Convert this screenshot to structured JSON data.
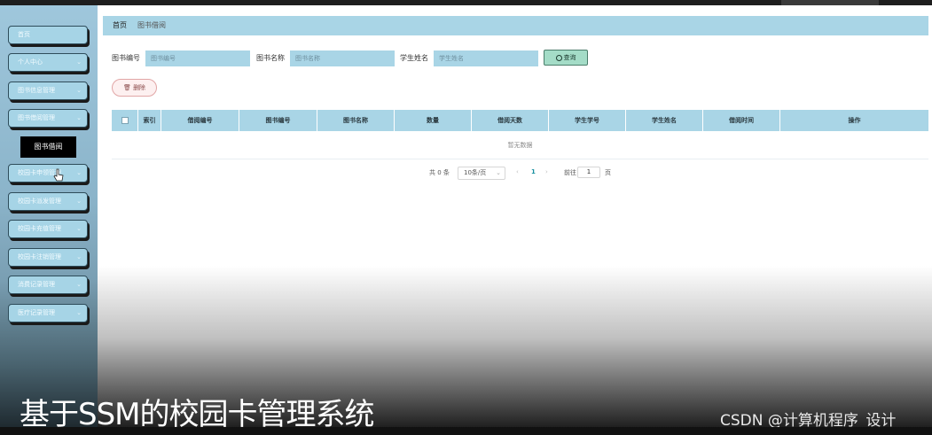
{
  "sidebar": {
    "items": [
      {
        "label": "首页",
        "has_chevron": false
      },
      {
        "label": "个人中心",
        "has_chevron": true
      },
      {
        "label": "图书信息管理",
        "has_chevron": true
      },
      {
        "label": "图书借阅管理",
        "has_chevron": true
      },
      {
        "label": "校园卡申领管理",
        "has_chevron": true
      },
      {
        "label": "校园卡派发管理",
        "has_chevron": true
      },
      {
        "label": "校园卡充值管理",
        "has_chevron": true
      },
      {
        "label": "校园卡注销管理",
        "has_chevron": true
      },
      {
        "label": "消费记录管理",
        "has_chevron": true
      },
      {
        "label": "医疗记录管理",
        "has_chevron": true
      }
    ],
    "active_sub": "图书借阅",
    "chevron_icon": "chevron-down-icon"
  },
  "breadcrumb": {
    "home": "首页",
    "current": "图书借阅"
  },
  "search": {
    "fields": [
      {
        "label": "图书编号",
        "placeholder": "图书编号"
      },
      {
        "label": "图书名称",
        "placeholder": "图书名称"
      },
      {
        "label": "学生姓名",
        "placeholder": "学生姓名"
      }
    ],
    "query_label": "查询",
    "query_icon": "search-icon"
  },
  "actions": {
    "delete_label": "删除",
    "delete_icon": "trash-icon"
  },
  "table": {
    "columns": [
      "索引",
      "借阅编号",
      "图书编号",
      "图书名称",
      "数量",
      "借阅天数",
      "学生学号",
      "学生姓名",
      "借阅时间",
      "操作"
    ],
    "rows": [],
    "empty_text": "暂无数据"
  },
  "pagination": {
    "total_text": "共 0 条",
    "page_size": "10条/页",
    "prev": "‹",
    "current_page": "1",
    "next": "›",
    "goto_label": "前往",
    "goto_value": "1",
    "page_suffix": "页"
  },
  "overlay": {
    "caption": "基于SSM的校园卡管理系统",
    "watermark": "CSDN @计算机程序_设计"
  },
  "colors": {
    "accent": "#a9d5e6",
    "query_button": "#a4dcc7",
    "delete_button_border": "#e1a6a6",
    "pager_active": "#1890a0"
  }
}
